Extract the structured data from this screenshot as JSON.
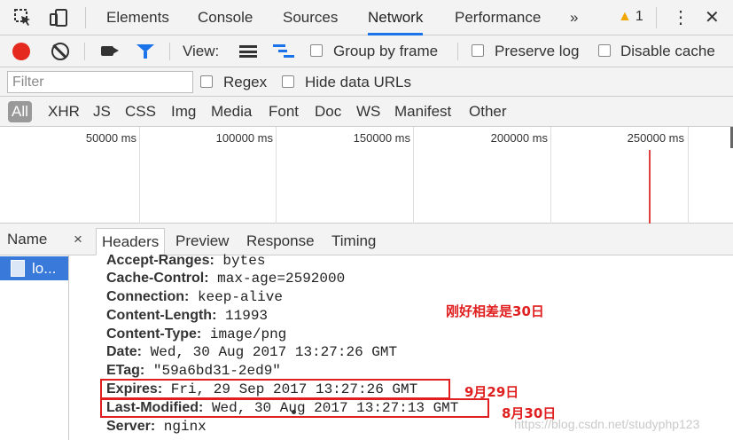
{
  "tabs": {
    "items": [
      "Elements",
      "Console",
      "Sources",
      "Network",
      "Performance"
    ],
    "active": "Network",
    "more": "»",
    "warning_count": "1",
    "menu": "⋮",
    "close": "✕"
  },
  "toolbar": {
    "view_label": "View:",
    "group_by_frame": "Group by frame",
    "preserve_log": "Preserve log",
    "disable_cache": "Disable cache"
  },
  "filter": {
    "placeholder": "Filter",
    "regex": "Regex",
    "hide_data_urls": "Hide data URLs"
  },
  "type_filters": [
    "All",
    "XHR",
    "JS",
    "CSS",
    "Img",
    "Media",
    "Font",
    "Doc",
    "WS",
    "Manifest",
    "Other"
  ],
  "overview": {
    "ticks": [
      "50000 ms",
      "100000 ms",
      "150000 ms",
      "200000 ms",
      "250000 ms"
    ]
  },
  "requests": {
    "column_name": "Name",
    "selected": "lo..."
  },
  "detail": {
    "close": "×",
    "tabs": [
      "Headers",
      "Preview",
      "Response",
      "Timing"
    ],
    "active": "Headers",
    "headers": [
      {
        "k": "Accept-Ranges:",
        "v": "bytes"
      },
      {
        "k": "Cache-Control:",
        "v": "max-age=2592000"
      },
      {
        "k": "Connection:",
        "v": "keep-alive"
      },
      {
        "k": "Content-Length:",
        "v": "11993"
      },
      {
        "k": "Content-Type:",
        "v": "image/png"
      },
      {
        "k": "Date:",
        "v": "Wed, 30 Aug 2017 13:27:26 GMT"
      },
      {
        "k": "ETag:",
        "v": "\"59a6bd31-2ed9\""
      },
      {
        "k": "Expires:",
        "v": "Fri, 29 Sep 2017 13:27:26 GMT"
      },
      {
        "k": "Last-Modified:",
        "v": "Wed, 30 Aug 2017 13:27:13 GMT"
      },
      {
        "k": "Server:",
        "v": "nginx"
      }
    ]
  },
  "annotations": {
    "diff_note": "刚好相差是30日",
    "expires_note": "9月29日",
    "modified_note": "8月30日",
    "color": "#e02020"
  },
  "watermark": "https://blog.csdn.net/studyphp123",
  "colors": {
    "accent": "#1a73e8",
    "record": "#e5291f",
    "selected_row": "#3879d9",
    "warning": "#f0a800"
  }
}
